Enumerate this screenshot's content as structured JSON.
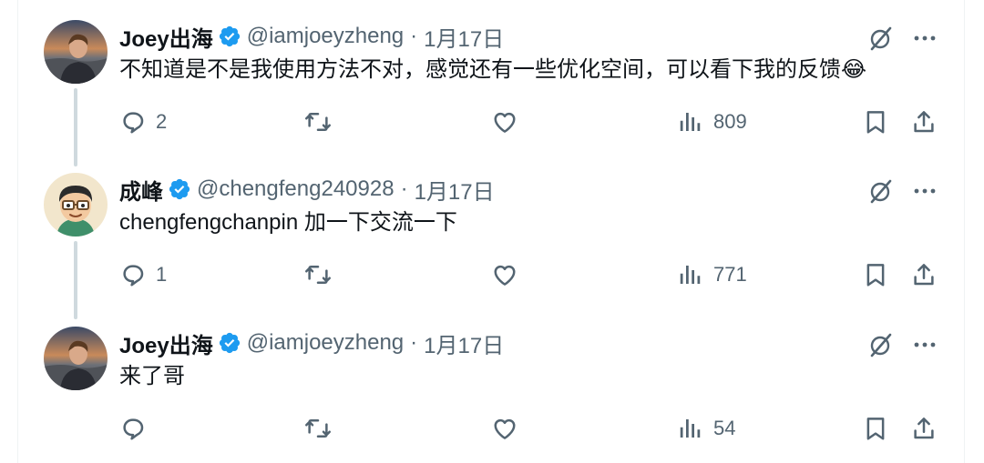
{
  "tweets": [
    {
      "author": "Joey出海",
      "handle": "@iamjoeyzheng",
      "separator": "·",
      "date": "1月17日",
      "text": "不知道是不是我使用方法不对，感觉还有一些优化空间，可以看下我的反馈😂",
      "replies": "2",
      "views": "809",
      "avatar": "photo-portrait-avatar"
    },
    {
      "author": "成峰",
      "handle": "@chengfeng240928",
      "separator": "·",
      "date": "1月17日",
      "text": "chengfengchanpin 加一下交流一下",
      "replies": "1",
      "views": "771",
      "avatar": "cartoon-glasses-avatar"
    },
    {
      "author": "Joey出海",
      "handle": "@iamjoeyzheng",
      "separator": "·",
      "date": "1月17日",
      "text": "来了哥",
      "replies": "",
      "views": "54",
      "avatar": "photo-portrait-avatar"
    }
  ],
  "icons": {
    "verified": "verified-badge-icon",
    "grok": "grok-icon",
    "more": "more-icon",
    "reply": "reply-icon",
    "retweet": "retweet-icon",
    "like": "like-icon",
    "views": "views-icon",
    "bookmark": "bookmark-icon",
    "share": "share-icon"
  },
  "colors": {
    "text": "#0f1419",
    "secondary": "#536471",
    "verified": "#1d9bf0",
    "thread_line": "#cfd9de",
    "border": "#eff3f4"
  }
}
